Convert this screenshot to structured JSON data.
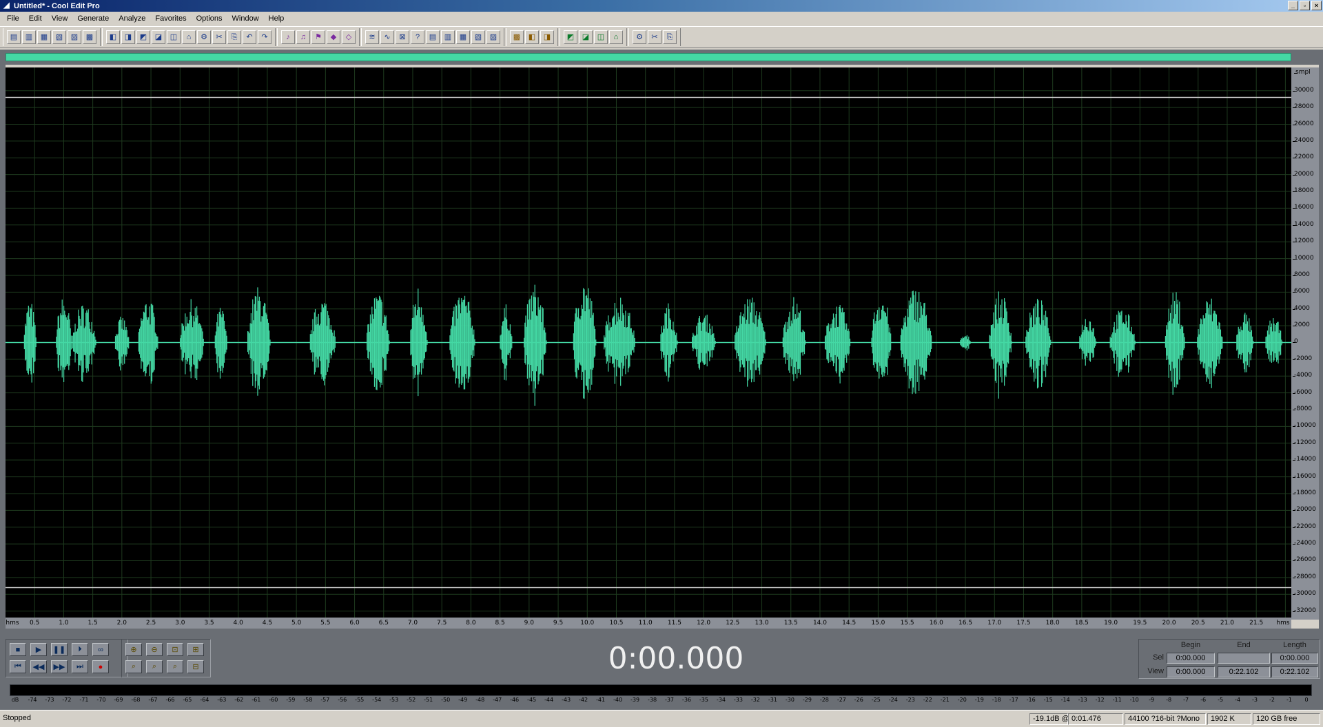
{
  "window": {
    "title": "Untitled* - Cool Edit Pro"
  },
  "menu": [
    "File",
    "Edit",
    "View",
    "Generate",
    "Analyze",
    "Favorites",
    "Options",
    "Window",
    "Help"
  ],
  "colors": {
    "waveform": "#44d8a4",
    "background": "#000000",
    "grid": "#1e3a1e",
    "panel": "#6a6e74"
  },
  "toolbar_icons": [
    [
      "multitrack-icon",
      "waveform-view-icon",
      "open-icon",
      "save-icon",
      "record-icon",
      "properties-icon"
    ],
    [
      "undo-icon",
      "redo-icon",
      "repeat-icon",
      "copy-icon",
      "paste-icon",
      "cut-icon",
      "trim-icon",
      "mix-paste-icon",
      "new-file-icon",
      "insert-icon",
      "settings-icon"
    ],
    [
      "amplify-icon",
      "envelope-icon",
      "equalizer-icon",
      "reverb-icon",
      "echo-icon"
    ],
    [
      "mono-icon",
      "stereo-icon",
      "noise-icon",
      "play-list-icon",
      "markers-icon",
      "convert-icon",
      "frequency-icon",
      "spectrum-icon",
      "sample-type-icon"
    ],
    [
      "cd-icon",
      "scripts-icon",
      "help-icon"
    ],
    [
      "analysis-icon",
      "statistics-icon",
      "filter-icon",
      "delay-icon"
    ],
    [
      "pitch-icon",
      "stretch-icon",
      "fullscreen-icon"
    ]
  ],
  "vertical_axis": {
    "unit": "smpl",
    "labels": [
      "30000",
      "28000",
      "26000",
      "24000",
      "22000",
      "20000",
      "18000",
      "16000",
      "14000",
      "12000",
      "10000",
      "8000",
      "6000",
      "4000",
      "2000",
      "0",
      "-2000",
      "-4000",
      "-6000",
      "-8000",
      "-10000",
      "-12000",
      "-14000",
      "-16000",
      "-18000",
      "-20000",
      "-22000",
      "-24000",
      "-26000",
      "-28000",
      "-30000",
      "-32000"
    ],
    "range": [
      -32768,
      32767
    ]
  },
  "time_axis": {
    "unit": "hms",
    "labels": [
      "0.5",
      "1.0",
      "1.5",
      "2.0",
      "2.5",
      "3.0",
      "3.5",
      "4.0",
      "4.5",
      "5.0",
      "5.5",
      "6.0",
      "6.5",
      "7.0",
      "7.5",
      "8.0",
      "8.5",
      "9.0",
      "9.5",
      "10.0",
      "10.5",
      "11.0",
      "11.5",
      "12.0",
      "12.5",
      "13.0",
      "13.5",
      "14.0",
      "14.5",
      "15.0",
      "15.5",
      "16.0",
      "16.5",
      "17.0",
      "17.5",
      "18.0",
      "18.5",
      "19.0",
      "19.5",
      "20.0",
      "20.5",
      "21.0",
      "21.5"
    ],
    "duration_seconds": 22.102
  },
  "waveform_bursts": [
    [
      0.42,
      0.22,
      5200
    ],
    [
      1.0,
      0.28,
      5600
    ],
    [
      1.35,
      0.42,
      4800
    ],
    [
      2.0,
      0.25,
      3200
    ],
    [
      2.45,
      0.35,
      5600
    ],
    [
      3.2,
      0.42,
      5200
    ],
    [
      3.7,
      0.22,
      4400
    ],
    [
      4.35,
      0.4,
      6800
    ],
    [
      5.45,
      0.45,
      5600
    ],
    [
      6.4,
      0.4,
      6200
    ],
    [
      7.1,
      0.3,
      7000
    ],
    [
      7.85,
      0.45,
      6400
    ],
    [
      8.6,
      0.22,
      4600
    ],
    [
      9.1,
      0.4,
      7200
    ],
    [
      9.95,
      0.4,
      8000
    ],
    [
      10.55,
      0.55,
      5800
    ],
    [
      11.4,
      0.3,
      4800
    ],
    [
      12.0,
      0.42,
      3600
    ],
    [
      12.8,
      0.55,
      5600
    ],
    [
      13.55,
      0.4,
      5600
    ],
    [
      14.3,
      0.45,
      4800
    ],
    [
      15.05,
      0.35,
      6400
    ],
    [
      15.65,
      0.55,
      6800
    ],
    [
      16.5,
      0.2,
      1000
    ],
    [
      17.1,
      0.4,
      6200
    ],
    [
      17.75,
      0.45,
      5400
    ],
    [
      18.6,
      0.3,
      3600
    ],
    [
      19.2,
      0.45,
      4200
    ],
    [
      20.1,
      0.35,
      6200
    ],
    [
      20.7,
      0.45,
      5600
    ],
    [
      21.3,
      0.3,
      3800
    ],
    [
      21.8,
      0.3,
      3200
    ]
  ],
  "transport": {
    "row1": [
      "stop-icon",
      "play-icon",
      "pause-icon",
      "play-to-end-icon",
      "loop-icon"
    ],
    "row2": [
      "go-to-start-icon",
      "rewind-icon",
      "fast-forward-icon",
      "go-to-end-icon",
      "record-button-icon"
    ]
  },
  "zoom": [
    "zoom-in-icon",
    "zoom-out-icon",
    "zoom-full-icon",
    "zoom-in-right-icon",
    "zoom-selection-icon",
    "zoom-left-icon",
    "zoom-right-icon",
    "zoom-out-full-icon"
  ],
  "time_display": "0:00.000",
  "selection": {
    "headers": [
      "Begin",
      "End",
      "Length"
    ],
    "sel_label": "Sel",
    "view_label": "View",
    "sel_begin": "0:00.000",
    "sel_end": "",
    "sel_length": "0:00.000",
    "view_begin": "0:00.000",
    "view_end": "0:22.102",
    "view_length": "0:22.102"
  },
  "level_meter": {
    "labels": [
      "dB",
      "-74",
      "-73",
      "-72",
      "-71",
      "-70",
      "-69",
      "-68",
      "-67",
      "-66",
      "-65",
      "-64",
      "-63",
      "-62",
      "-61",
      "-60",
      "-59",
      "-58",
      "-57",
      "-56",
      "-55",
      "-54",
      "-53",
      "-52",
      "-51",
      "-50",
      "-49",
      "-48",
      "-47",
      "-46",
      "-45",
      "-44",
      "-43",
      "-42",
      "-41",
      "-40",
      "-39",
      "-38",
      "-37",
      "-36",
      "-35",
      "-34",
      "-33",
      "-32",
      "-31",
      "-30",
      "-29",
      "-28",
      "-27",
      "-26",
      "-25",
      "-24",
      "-23",
      "-22",
      "-21",
      "-20",
      "-19",
      "-18",
      "-17",
      "-16",
      "-15",
      "-14",
      "-13",
      "-12",
      "-11",
      "-10",
      "-9",
      "-8",
      "-7",
      "-6",
      "-5",
      "-4",
      "-3",
      "-2",
      "-1",
      "0"
    ]
  },
  "status": {
    "state": "Stopped",
    "level": "-19.1dB @",
    "time": "0:01.476",
    "format": "44100 ?16-bit ?Mono",
    "size": "1902 K",
    "free": "120 GB free"
  }
}
